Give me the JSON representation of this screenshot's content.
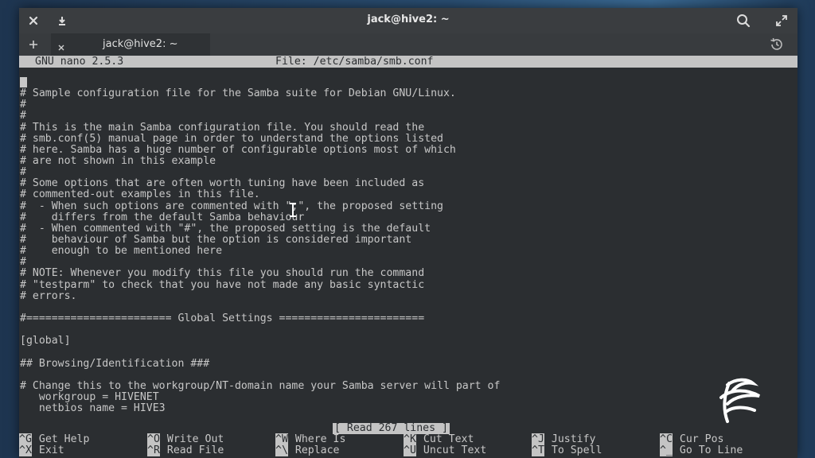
{
  "window": {
    "title": "jack@hive2: ~"
  },
  "tabs": [
    {
      "label": "jack@hive2: ~"
    }
  ],
  "nano": {
    "version": "GNU nano 2.5.3",
    "file_label": "File: /etc/samba/smb.conf",
    "status_message": "[ Read 267 lines ]"
  },
  "file_lines": [
    "",
    "# Sample configuration file for the Samba suite for Debian GNU/Linux.",
    "#",
    "#",
    "# This is the main Samba configuration file. You should read the",
    "# smb.conf(5) manual page in order to understand the options listed",
    "# here. Samba has a huge number of configurable options most of which",
    "# are not shown in this example",
    "#",
    "# Some options that are often worth tuning have been included as",
    "# commented-out examples in this file.",
    "#  - When such options are commented with \";\", the proposed setting",
    "#    differs from the default Samba behaviour",
    "#  - When commented with \"#\", the proposed setting is the default",
    "#    behaviour of Samba but the option is considered important",
    "#    enough to be mentioned here",
    "#",
    "# NOTE: Whenever you modify this file you should run the command",
    "# \"testparm\" to check that you have not made any basic syntactic",
    "# errors.",
    "",
    "#======================= Global Settings =======================",
    "",
    "[global]",
    "",
    "## Browsing/Identification ###",
    "",
    "# Change this to the workgroup/NT-domain name your Samba server will part of",
    "   workgroup = HIVENET",
    "   netbios name = HIVE3"
  ],
  "shortcuts": [
    {
      "key": "^G",
      "label": "Get Help"
    },
    {
      "key": "^O",
      "label": "Write Out"
    },
    {
      "key": "^W",
      "label": "Where Is"
    },
    {
      "key": "^K",
      "label": "Cut Text"
    },
    {
      "key": "^J",
      "label": "Justify"
    },
    {
      "key": "^C",
      "label": "Cur Pos"
    },
    {
      "key": "^X",
      "label": "Exit"
    },
    {
      "key": "^R",
      "label": "Read File"
    },
    {
      "key": "^\\",
      "label": "Replace"
    },
    {
      "key": "^U",
      "label": "Uncut Text"
    },
    {
      "key": "^T",
      "label": "To Spell"
    },
    {
      "key": "^_",
      "label": "Go To Line"
    }
  ],
  "icons": {
    "close": "close-icon",
    "download": "download-icon",
    "search": "search-icon",
    "maximize": "maximize-icon",
    "new_tab": "plus-icon",
    "tab_close": "close-icon",
    "history": "history-icon"
  },
  "colors": {
    "terminal_bg": "#2b2e31",
    "terminal_fg": "#c7c7c7",
    "nano_bar": "#c4c4c4",
    "titlebar": "#3a3d40"
  }
}
